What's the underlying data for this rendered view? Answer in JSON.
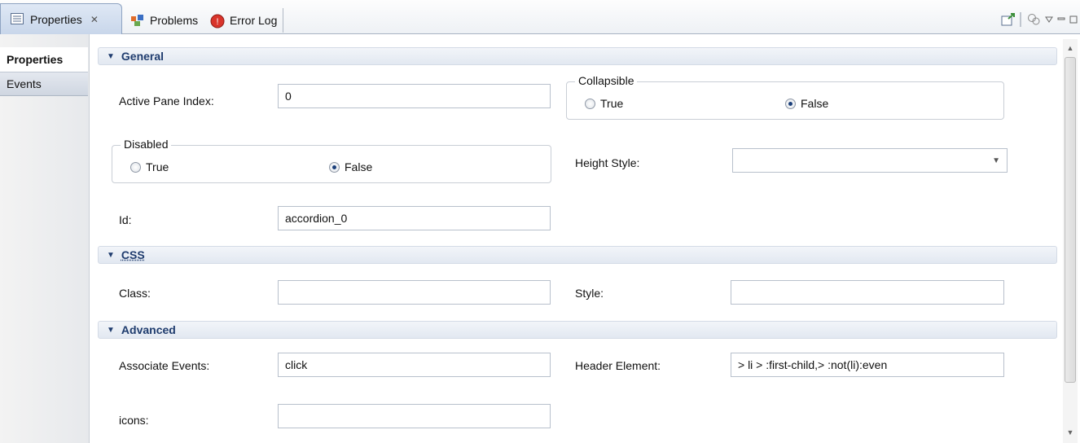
{
  "tabs": [
    {
      "label": "Properties",
      "close": "✕",
      "icon": "properties-icon"
    },
    {
      "label": "Problems",
      "icon": "problems-icon"
    },
    {
      "label": "Error Log",
      "icon": "error-log-icon"
    }
  ],
  "toolbar": {
    "pin_icon": "pin-icon",
    "filter_icon": "filter-icon"
  },
  "side_tabs": [
    {
      "label": "Properties"
    },
    {
      "label": "Events"
    }
  ],
  "general": {
    "title": "General",
    "active_pane_index": {
      "label": "Active Pane Index:",
      "value": "0"
    },
    "collapsible": {
      "legend": "Collapsible",
      "true_label": "True",
      "false_label": "False",
      "selected": "False"
    },
    "disabled": {
      "legend": "Disabled",
      "true_label": "True",
      "false_label": "False",
      "selected": "False"
    },
    "height_style": {
      "label": "Height Style:",
      "value": ""
    },
    "id": {
      "label": "Id:",
      "value": "accordion_0"
    }
  },
  "css": {
    "title": "CSS",
    "class": {
      "label": "Class:",
      "value": ""
    },
    "style": {
      "label": "Style:",
      "value": ""
    }
  },
  "advanced": {
    "title": "Advanced",
    "associate_events": {
      "label": "Associate Events:",
      "value": "click"
    },
    "header_element": {
      "label": "Header Element:",
      "value": "> li > :first-child,> :not(li):even"
    },
    "icons": {
      "label": "icons:",
      "value": ""
    }
  },
  "colors": {
    "section_text": "#1f3c6e",
    "selected_radio": "#1b3f7a"
  }
}
